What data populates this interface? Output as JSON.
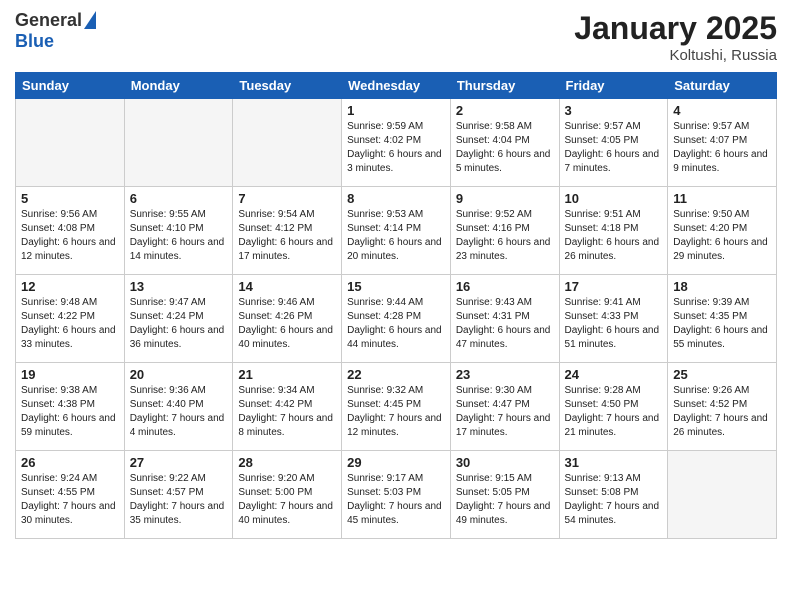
{
  "header": {
    "logo_general": "General",
    "logo_blue": "Blue",
    "month_title": "January 2025",
    "location": "Koltushi, Russia"
  },
  "days_of_week": [
    "Sunday",
    "Monday",
    "Tuesday",
    "Wednesday",
    "Thursday",
    "Friday",
    "Saturday"
  ],
  "weeks": [
    [
      {
        "day": "",
        "info": ""
      },
      {
        "day": "",
        "info": ""
      },
      {
        "day": "",
        "info": ""
      },
      {
        "day": "1",
        "info": "Sunrise: 9:59 AM\nSunset: 4:02 PM\nDaylight: 6 hours and 3 minutes."
      },
      {
        "day": "2",
        "info": "Sunrise: 9:58 AM\nSunset: 4:04 PM\nDaylight: 6 hours and 5 minutes."
      },
      {
        "day": "3",
        "info": "Sunrise: 9:57 AM\nSunset: 4:05 PM\nDaylight: 6 hours and 7 minutes."
      },
      {
        "day": "4",
        "info": "Sunrise: 9:57 AM\nSunset: 4:07 PM\nDaylight: 6 hours and 9 minutes."
      }
    ],
    [
      {
        "day": "5",
        "info": "Sunrise: 9:56 AM\nSunset: 4:08 PM\nDaylight: 6 hours and 12 minutes."
      },
      {
        "day": "6",
        "info": "Sunrise: 9:55 AM\nSunset: 4:10 PM\nDaylight: 6 hours and 14 minutes."
      },
      {
        "day": "7",
        "info": "Sunrise: 9:54 AM\nSunset: 4:12 PM\nDaylight: 6 hours and 17 minutes."
      },
      {
        "day": "8",
        "info": "Sunrise: 9:53 AM\nSunset: 4:14 PM\nDaylight: 6 hours and 20 minutes."
      },
      {
        "day": "9",
        "info": "Sunrise: 9:52 AM\nSunset: 4:16 PM\nDaylight: 6 hours and 23 minutes."
      },
      {
        "day": "10",
        "info": "Sunrise: 9:51 AM\nSunset: 4:18 PM\nDaylight: 6 hours and 26 minutes."
      },
      {
        "day": "11",
        "info": "Sunrise: 9:50 AM\nSunset: 4:20 PM\nDaylight: 6 hours and 29 minutes."
      }
    ],
    [
      {
        "day": "12",
        "info": "Sunrise: 9:48 AM\nSunset: 4:22 PM\nDaylight: 6 hours and 33 minutes."
      },
      {
        "day": "13",
        "info": "Sunrise: 9:47 AM\nSunset: 4:24 PM\nDaylight: 6 hours and 36 minutes."
      },
      {
        "day": "14",
        "info": "Sunrise: 9:46 AM\nSunset: 4:26 PM\nDaylight: 6 hours and 40 minutes."
      },
      {
        "day": "15",
        "info": "Sunrise: 9:44 AM\nSunset: 4:28 PM\nDaylight: 6 hours and 44 minutes."
      },
      {
        "day": "16",
        "info": "Sunrise: 9:43 AM\nSunset: 4:31 PM\nDaylight: 6 hours and 47 minutes."
      },
      {
        "day": "17",
        "info": "Sunrise: 9:41 AM\nSunset: 4:33 PM\nDaylight: 6 hours and 51 minutes."
      },
      {
        "day": "18",
        "info": "Sunrise: 9:39 AM\nSunset: 4:35 PM\nDaylight: 6 hours and 55 minutes."
      }
    ],
    [
      {
        "day": "19",
        "info": "Sunrise: 9:38 AM\nSunset: 4:38 PM\nDaylight: 6 hours and 59 minutes."
      },
      {
        "day": "20",
        "info": "Sunrise: 9:36 AM\nSunset: 4:40 PM\nDaylight: 7 hours and 4 minutes."
      },
      {
        "day": "21",
        "info": "Sunrise: 9:34 AM\nSunset: 4:42 PM\nDaylight: 7 hours and 8 minutes."
      },
      {
        "day": "22",
        "info": "Sunrise: 9:32 AM\nSunset: 4:45 PM\nDaylight: 7 hours and 12 minutes."
      },
      {
        "day": "23",
        "info": "Sunrise: 9:30 AM\nSunset: 4:47 PM\nDaylight: 7 hours and 17 minutes."
      },
      {
        "day": "24",
        "info": "Sunrise: 9:28 AM\nSunset: 4:50 PM\nDaylight: 7 hours and 21 minutes."
      },
      {
        "day": "25",
        "info": "Sunrise: 9:26 AM\nSunset: 4:52 PM\nDaylight: 7 hours and 26 minutes."
      }
    ],
    [
      {
        "day": "26",
        "info": "Sunrise: 9:24 AM\nSunset: 4:55 PM\nDaylight: 7 hours and 30 minutes."
      },
      {
        "day": "27",
        "info": "Sunrise: 9:22 AM\nSunset: 4:57 PM\nDaylight: 7 hours and 35 minutes."
      },
      {
        "day": "28",
        "info": "Sunrise: 9:20 AM\nSunset: 5:00 PM\nDaylight: 7 hours and 40 minutes."
      },
      {
        "day": "29",
        "info": "Sunrise: 9:17 AM\nSunset: 5:03 PM\nDaylight: 7 hours and 45 minutes."
      },
      {
        "day": "30",
        "info": "Sunrise: 9:15 AM\nSunset: 5:05 PM\nDaylight: 7 hours and 49 minutes."
      },
      {
        "day": "31",
        "info": "Sunrise: 9:13 AM\nSunset: 5:08 PM\nDaylight: 7 hours and 54 minutes."
      },
      {
        "day": "",
        "info": ""
      }
    ]
  ]
}
